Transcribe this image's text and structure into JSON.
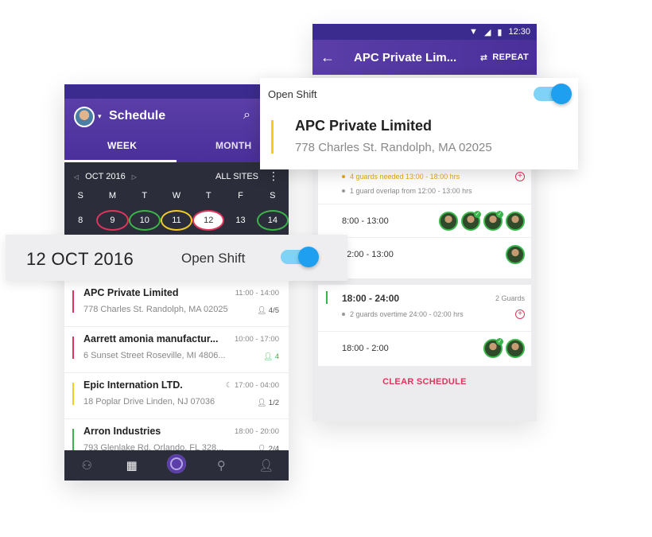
{
  "right_phone": {
    "status_time": "12:30",
    "title": "APC Private Lim...",
    "repeat_label": "REPEAT",
    "card_a": {
      "note_warn": "4 guards needed 13:00 - 18:00 hrs",
      "note": "1 guard overlap from 12:00 - 13:00 hrs",
      "slots": [
        {
          "time": "8:00 - 13:00",
          "guards": 4
        },
        {
          "time": "12:00 - 13:00",
          "guards": 1
        }
      ]
    },
    "card_b": {
      "time": "18:00 - 24:00",
      "guards_label": "2 Guards",
      "note": "2 guards overtime 24:00 - 02:00 hrs",
      "slot_time": "18:00 - 2:00"
    },
    "clear_label": "CLEAR SCHEDULE"
  },
  "popup": {
    "label": "Open Shift",
    "company": "APC Private Limited",
    "address": "778 Charles St. Randolph, MA 02025"
  },
  "left_phone": {
    "title": "Schedule",
    "tab_week": "WEEK",
    "tab_month": "MONTH",
    "calendar": {
      "month": "OCT 2016",
      "sites": "ALL SITES",
      "dows": [
        "S",
        "M",
        "T",
        "W",
        "T",
        "F",
        "S"
      ],
      "days": [
        "8",
        "9",
        "10",
        "11",
        "12",
        "13",
        "14"
      ]
    },
    "list": [
      {
        "name": "APC Private Limited",
        "address": "778 Charles St. Randolph, MA 02025",
        "time": "11:00 - 14:00",
        "count": "4/5",
        "color": "#e2335d"
      },
      {
        "name": "Aarrett amonia manufactur...",
        "address": "6 Sunset Street Roseville, MI 4806...",
        "time": "10:00 - 17:00",
        "count": "4",
        "color": "#e2335d"
      },
      {
        "name": "Epic Internation LTD.",
        "address": "18 Poplar Drive Linden, NJ 07036",
        "time": "17:00 - 04:00",
        "count": "1/2",
        "color": "#f2cb23"
      },
      {
        "name": "Arron Industries",
        "address": "793 Glenlake Rd. Orlando, FL 328...",
        "time": "18:00 - 20:00",
        "count": "2/4",
        "color": "#3ab54a"
      }
    ]
  },
  "banner": {
    "date": "12 OCT 2016",
    "label": "Open Shift"
  }
}
